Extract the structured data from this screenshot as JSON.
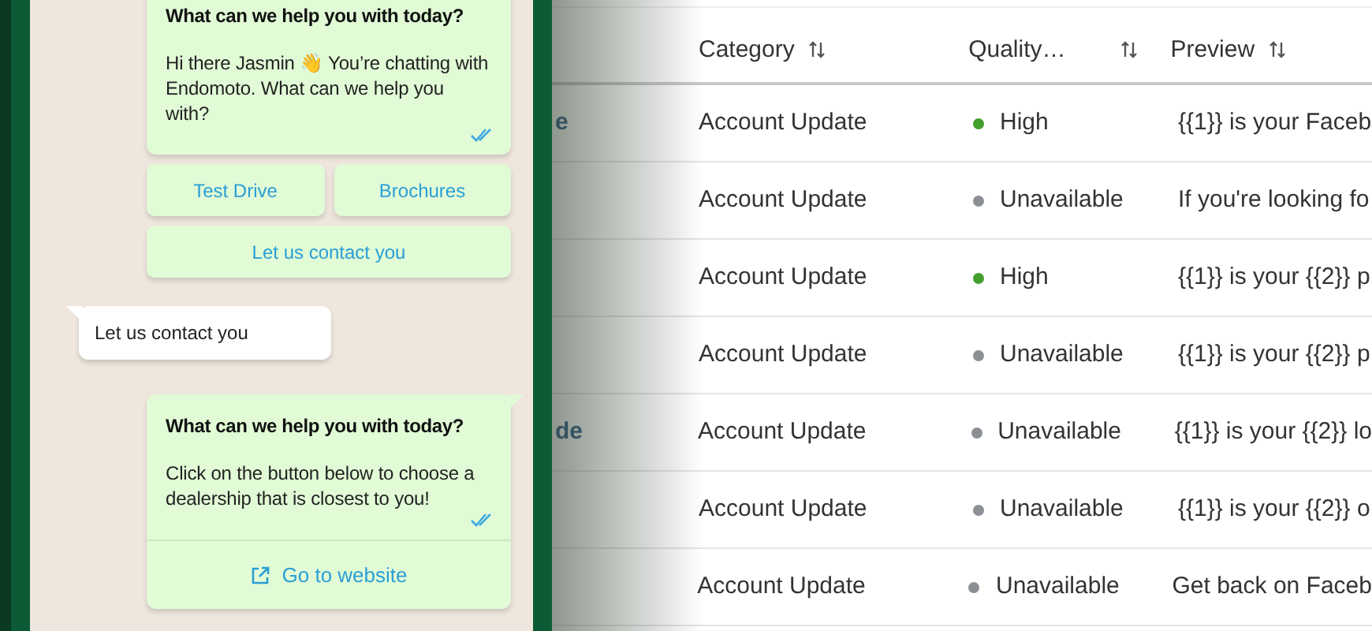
{
  "chat": {
    "messages": [
      {
        "kind": "outgoing",
        "title": "What can we help you with today?",
        "text": "Hi there Jasmin 👋  You’re chatting with Endomoto. What can we help you with?",
        "read": true,
        "buttons": [
          "Test Drive",
          "Brochures",
          "Let us contact you"
        ]
      },
      {
        "kind": "incoming",
        "text": "Let us contact you"
      },
      {
        "kind": "outgoing",
        "title": "What can we help you with today?",
        "text": "Click on the button below to choose a dealership that is closest to you!",
        "read": true,
        "link": "Go to website"
      }
    ]
  },
  "table": {
    "columns": [
      {
        "label": "Category"
      },
      {
        "label": "Quality…"
      },
      {
        "label": "Preview"
      }
    ],
    "rows": [
      {
        "name": "e",
        "category": "Account Update",
        "quality": "High",
        "color": "#43a02e",
        "preview": "{{1}} is your Faceb"
      },
      {
        "category": "Account Update",
        "quality": "Unavailable",
        "color": "#8c8f94",
        "preview": "If you're looking fo"
      },
      {
        "category": "Account Update",
        "quality": "High",
        "color": "#43a02e",
        "preview": "{{1}} is your {{2}} p"
      },
      {
        "category": "Account Update",
        "quality": "Unavailable",
        "color": "#8c8f94",
        "preview": "{{1}} is your {{2}} p"
      },
      {
        "name": "de",
        "category": "Account Update",
        "quality": "Unavailable",
        "color": "#8c8f94",
        "preview": "{{1}} is your {{2}} lo"
      },
      {
        "category": "Account Update",
        "quality": "Unavailable",
        "color": "#8c8f94",
        "preview": "{{1}} is your {{2}} o"
      },
      {
        "category": "Account Update",
        "quality": "Unavailable",
        "color": "#8c8f94",
        "preview": "Get back on Faceb"
      }
    ]
  }
}
